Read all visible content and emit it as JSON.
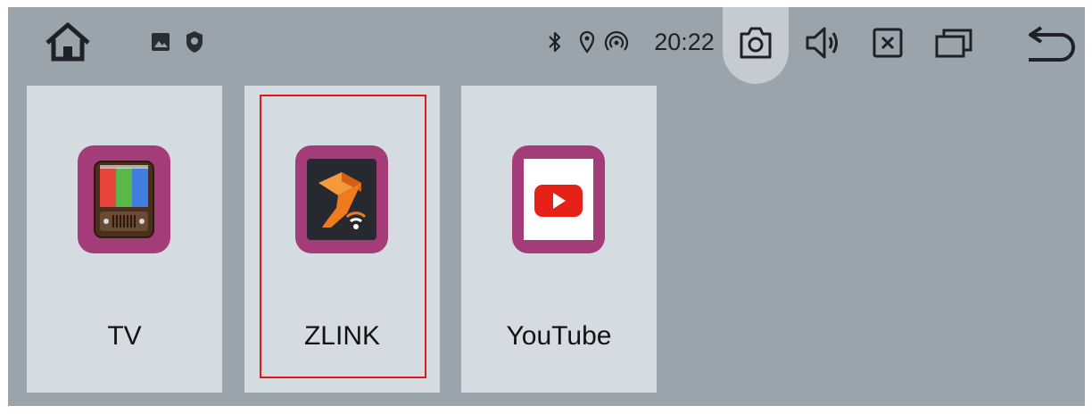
{
  "statusbar": {
    "clock": "20:22",
    "icons": {
      "home": "home-icon",
      "gallery": "image-icon",
      "shield": "shield-icon",
      "bluetooth": "bluetooth-icon",
      "location": "location-pin-icon",
      "hotspot": "hotspot-icon",
      "camera": "camera-icon",
      "volume": "volume-icon",
      "close": "close-box-icon",
      "recent": "recent-apps-icon",
      "back": "back-arrow-icon"
    }
  },
  "apps": [
    {
      "label": "TV",
      "icon": "tv-app-icon"
    },
    {
      "label": "ZLINK",
      "icon": "zlink-app-icon",
      "selected": true
    },
    {
      "label": "YouTube",
      "icon": "youtube-app-icon"
    }
  ],
  "colors": {
    "background": "#9aa4ac",
    "tile": "#d5dce1",
    "icon_background": "#a43c7a",
    "selection_border": "#e01818",
    "youtube_red": "#e62117",
    "zlink_orange": "#f07b1f"
  }
}
